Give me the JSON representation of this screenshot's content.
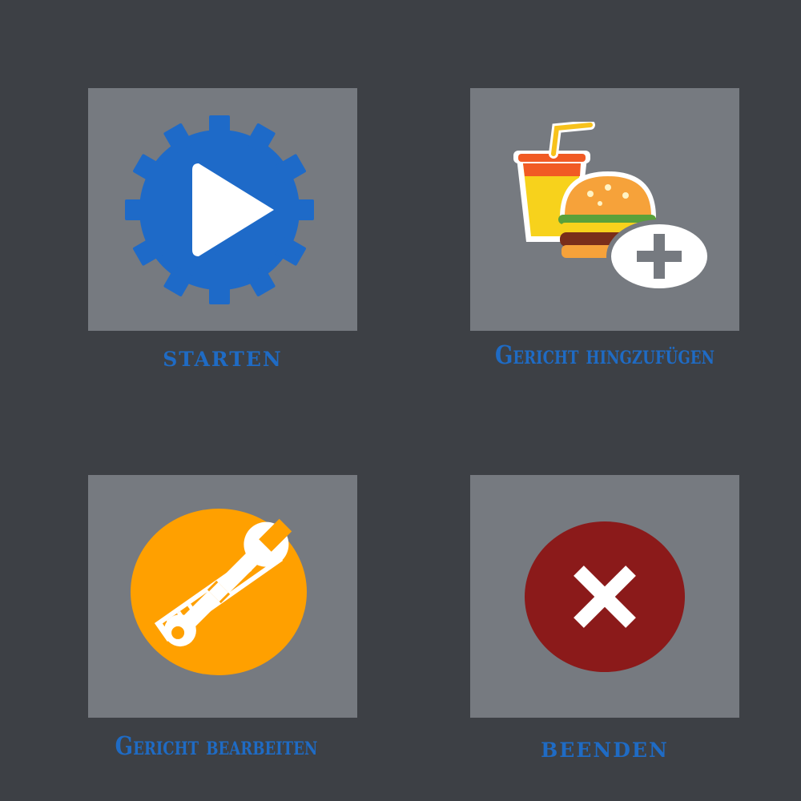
{
  "menu": {
    "items": [
      {
        "id": "start",
        "label": "starten",
        "icon": "gear-play-icon",
        "color": "#1e6ac8"
      },
      {
        "id": "add",
        "label": "Gericht hingzufügen",
        "icon": "food-add-icon",
        "color": "#f9a21b"
      },
      {
        "id": "edit",
        "label": "Gericht bearbeiten",
        "icon": "tools-icon",
        "color": "#ffa000"
      },
      {
        "id": "quit",
        "label": "beenden",
        "icon": "close-icon",
        "color": "#8b1a1a"
      }
    ]
  },
  "colors": {
    "background": "#3d4045",
    "tile": "#767a80",
    "label": "#1f6bc4"
  }
}
